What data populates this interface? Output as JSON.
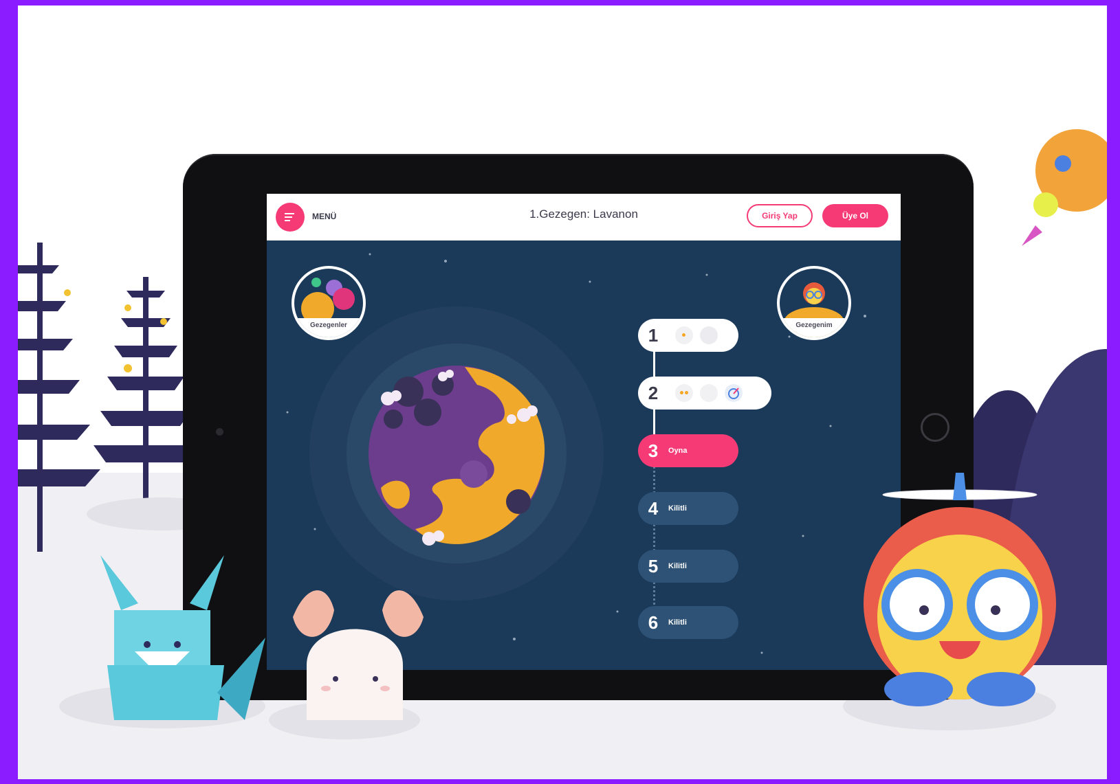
{
  "header": {
    "menu_label": "MENÜ",
    "title": "1.Gezegen: Lavanon",
    "login_label": "Giriş Yap",
    "signup_label": "Üye Ol"
  },
  "nav": {
    "planets_label": "Gezegenler",
    "my_planet_label": "Gezegenim"
  },
  "levels": [
    {
      "number": "1",
      "status": "completed",
      "text": ""
    },
    {
      "number": "2",
      "status": "completed",
      "text": ""
    },
    {
      "number": "3",
      "status": "current",
      "text": "Oyna"
    },
    {
      "number": "4",
      "status": "locked",
      "text": "Kilitli"
    },
    {
      "number": "5",
      "status": "locked",
      "text": "Kilitli"
    },
    {
      "number": "6",
      "status": "locked",
      "text": "Kilitli"
    }
  ],
  "colors": {
    "frame": "#8a1cff",
    "accent": "#f53a75",
    "screen_bg": "#1b3a5a",
    "locked": "#2e5275",
    "planet_purple": "#6b3d8c",
    "planet_orange": "#f0a92a"
  },
  "icons": [
    "menu-icon",
    "planets-icon",
    "avatar-icon",
    "star-icon",
    "book-icon",
    "rocket-icon"
  ]
}
